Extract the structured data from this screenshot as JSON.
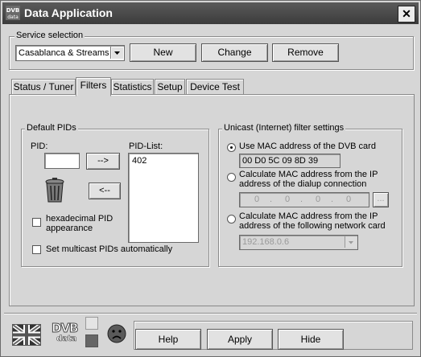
{
  "window": {
    "title": "Data Application",
    "close_glyph": "✕",
    "app_icon": "dvb-icon"
  },
  "service": {
    "label": "Service selection",
    "selected": "Casablanca & Streams",
    "new_label": "New",
    "change_label": "Change",
    "remove_label": "Remove"
  },
  "tabs": [
    "Status / Tuner",
    "Filters",
    "Statistics",
    "Setup",
    "Device Test"
  ],
  "active_tab": "Filters",
  "default_pids": {
    "label": "Default PIDs",
    "pid_label": "PID:",
    "pid_value": "",
    "add_label": "-->",
    "remove_label": "<--",
    "pid_list_label": "PID-List:",
    "pid_list": [
      "402"
    ],
    "hex_label_1": "hexadecimal PID",
    "hex_label_2": "appearance",
    "multicast_label": "Set multicast PIDs automatically",
    "hex_checked": false,
    "multicast_checked": false
  },
  "unicast": {
    "label": "Unicast (Internet) filter settings",
    "opt1": "Use MAC address of the DVB card",
    "mac_value": "00 D0 5C 09 8D 39",
    "opt2_line1": "Calculate MAC address from the IP",
    "opt2_line2": "address of the dialup connection",
    "ip_octets": [
      "0",
      "0",
      "0",
      "0"
    ],
    "ip_dot": ".",
    "browse_label": "...",
    "opt3_line1": "Calculate MAC address from the IP",
    "opt3_line2": "address of the following network card",
    "network_card": "192.168.0.6",
    "selected_option": 1
  },
  "footer": {
    "dvb_logo_top": "DVB",
    "dvb_logo_bottom": "data",
    "help_label": "Help",
    "apply_label": "Apply",
    "hide_label": "Hide"
  }
}
